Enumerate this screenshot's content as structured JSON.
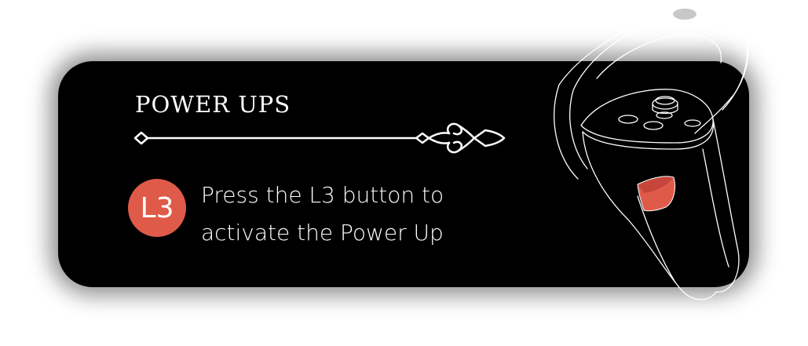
{
  "panel": {
    "title": "POWER UPS",
    "button_badge": "L3",
    "instruction_line1": "Press the L3 button to",
    "instruction_line2": "activate the Power Up"
  },
  "icons": {
    "divider": "ornamental-divider-icon",
    "controller": "vr-controller-illustration"
  },
  "colors": {
    "panel_bg": "#000000",
    "text": "#ffffff",
    "accent": "#e05a4a"
  }
}
